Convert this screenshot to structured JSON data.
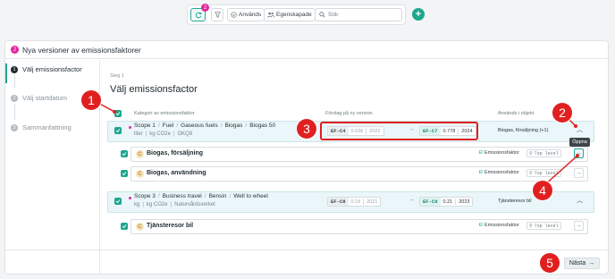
{
  "toolbar": {
    "badge_count": "2",
    "filter_used_label": "Används",
    "filter_custom_label": "Egenskapade",
    "search_placeholder": "Sök",
    "add_label": "+"
  },
  "panel": {
    "title_badge": "2",
    "title": "Nya versioner av emissionsfaktorer"
  },
  "steps": [
    {
      "num": "1",
      "label": "Välj emissionsfactor"
    },
    {
      "num": "2",
      "label": "Välj startdatum"
    },
    {
      "num": "3",
      "label": "Sammanfattning"
    }
  ],
  "content": {
    "step_hint": "Steg 1",
    "heading": "Välj emissionsfactor",
    "col_category": "Kategori av emissionsfaktor",
    "col_proposal": "Förslag på ny version",
    "col_used": "Används i objekt"
  },
  "groups": [
    {
      "path": [
        "Scope 1",
        "Fuel",
        "Gaseous fuels",
        "Biogas",
        "Biogas 50"
      ],
      "meta": [
        "liter",
        "kg CO2e",
        "OKQ8"
      ],
      "old_code": "EF-C4",
      "old_value": "0.636",
      "old_year": "2022",
      "new_code": "EF-C7",
      "new_value": "0.778",
      "new_year": "2024",
      "used": "Biogas, försäljning (+1)",
      "items": [
        {
          "name": "Biogas, försäljning",
          "type": "Emissionsfaktor",
          "tag": "Top level",
          "icon": "C"
        },
        {
          "name": "Biogas, användning",
          "type": "Emissionsfaktor",
          "tag": "Top level",
          "icon": "C"
        }
      ]
    },
    {
      "path": [
        "Scope 3",
        "Business travel",
        "Bensin",
        "Well to wheel"
      ],
      "meta": [
        "kg",
        "kg CO2e",
        "Naturvårdsverket"
      ],
      "old_code": "EF-C8",
      "old_value": "0.19",
      "old_year": "2021",
      "new_code": "EF-C9",
      "new_value": "0.21",
      "new_year": "2023",
      "used": "Tjänsteresor bil",
      "items": [
        {
          "name": "Tjänsteresor bil",
          "type": "Emissionsfaktor",
          "tag": "Top level",
          "icon": "C"
        }
      ]
    }
  ],
  "tooltip": "Öppna",
  "next_label": "Nästa",
  "annotations": [
    "1",
    "2",
    "3",
    "4",
    "5"
  ],
  "colors": {
    "accent": "#1ea68f",
    "pink": "#e1279b",
    "annotation": "#e02020"
  }
}
